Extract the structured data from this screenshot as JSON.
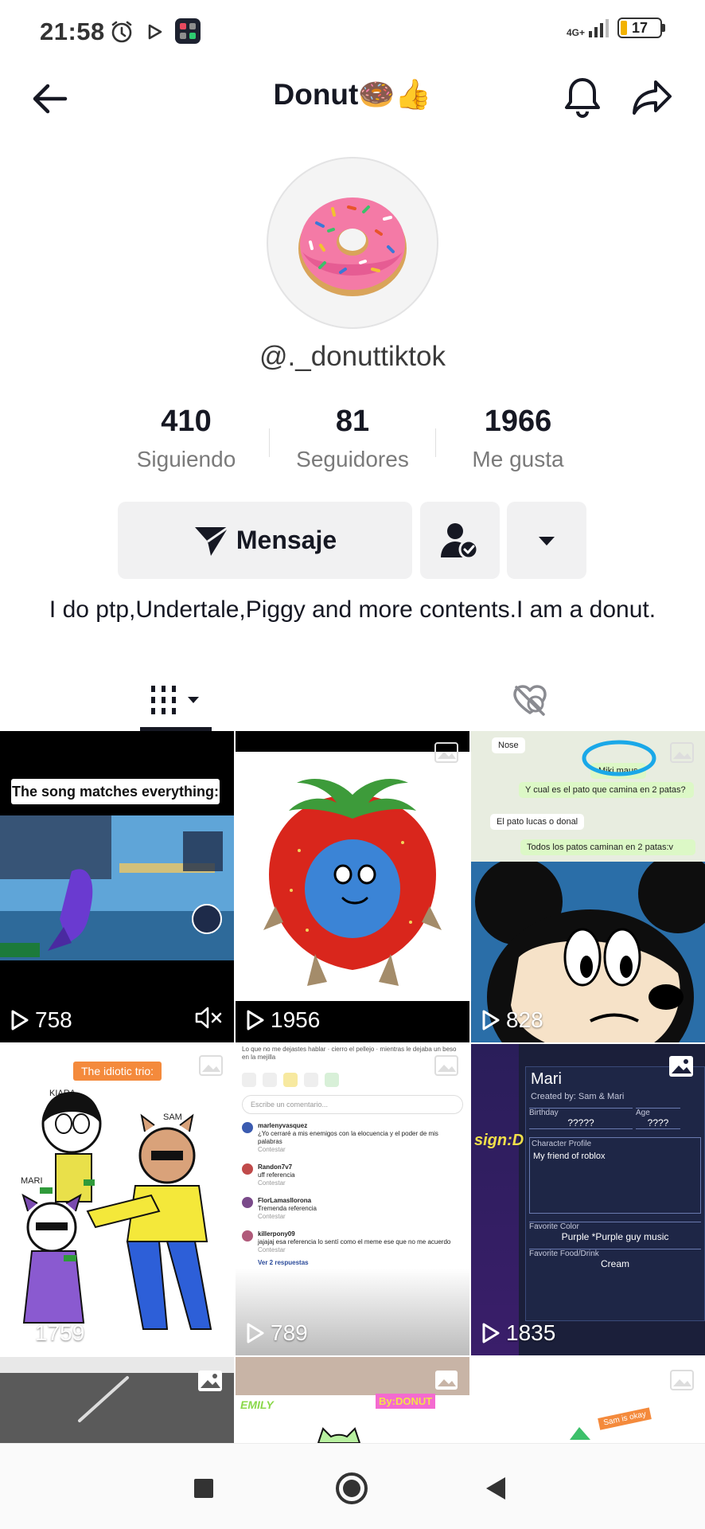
{
  "status_bar": {
    "time": "21:58",
    "network": "4G+",
    "battery": "17",
    "battery_level": 0.17
  },
  "header": {
    "title": "Donut🍩👍"
  },
  "profile": {
    "username": "@._donuttiktok",
    "stats": [
      {
        "value": "410",
        "label": "Siguiendo"
      },
      {
        "value": "81",
        "label": "Seguidores"
      },
      {
        "value": "1966",
        "label": "Me gusta"
      }
    ],
    "message_label": "Mensaje",
    "bio": "I do ptp,Undertale,Piggy and more contents.I am a donut."
  },
  "tabs": {
    "videos_icon": "grid-icon",
    "liked_icon": "liked-hidden-icon"
  },
  "grid": {
    "tiles": [
      {
        "count": "758",
        "caption": "The song matches everything:",
        "muted": true
      },
      {
        "count": "1956"
      },
      {
        "count": "828",
        "chat": [
          "Nose",
          "Miki maus",
          "Y cual es el pato que camina en 2 patas?",
          "El pato lucas o donal",
          "Todos los patos caminan en 2 patas:v"
        ]
      },
      {
        "count": "1759",
        "caption": "The idiotic trio:",
        "names": [
          "KIARA",
          "SAM",
          "MARI"
        ]
      },
      {
        "count": "789",
        "comment_placeholder": "Escribe un comentario...",
        "comments": [
          {
            "user": "marlenyvasquez",
            "text": "¿Yo cerraré a mis enemigos con la elocuencia y el poder de mis palabras",
            "reply": "Contestar"
          },
          {
            "user": "Randon7v7",
            "text": "uff referencia",
            "reply": "Contestar"
          },
          {
            "user": "FlorLamasllorona",
            "text": "Tremenda referencia",
            "reply": "Contestar"
          },
          {
            "user": "killerpony09",
            "text": "jajajaj esa referencia lo sentí como el meme ese que no me acuerdo",
            "reply": "Contestar"
          }
        ],
        "more_replies": "Ver 2 respuestas"
      },
      {
        "count": "1835",
        "card": {
          "name": "Mari",
          "created_by": "Created by: Sam & Mari",
          "birthday_label": "Birthday",
          "birthday": "?????",
          "age_label": "Age",
          "age": "????",
          "profile_label": "Character Profile",
          "profile": "My friend of roblox",
          "color_label": "Favorite Color",
          "color": "Purple *Purple guy music",
          "food_label": "Favorite Food/Drink",
          "food": "Cream",
          "side_text": "sign:D"
        }
      },
      {
        "count": ""
      },
      {
        "count": "",
        "texts": [
          "EMILY",
          "By:DONUT"
        ]
      },
      {
        "count": "",
        "texts": [
          "Sam is okay"
        ]
      }
    ]
  },
  "colors": {
    "text_primary": "#161823",
    "text_secondary": "#7a7a7a",
    "button_bg": "#f1f1f2"
  }
}
